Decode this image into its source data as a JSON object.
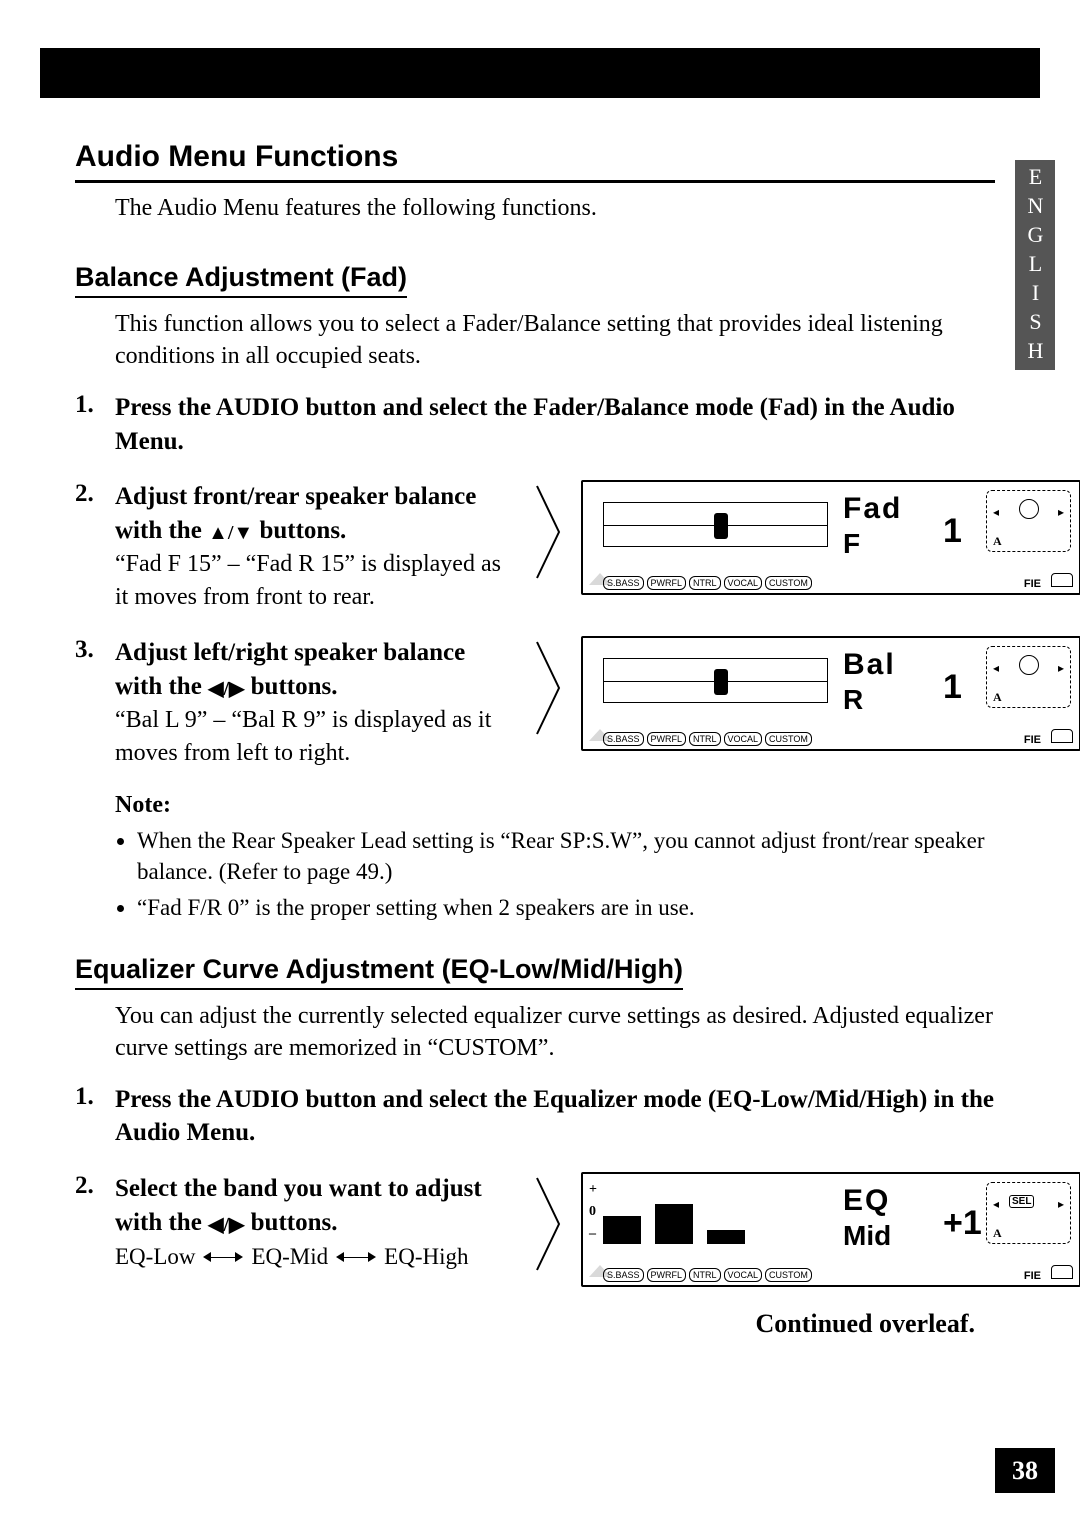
{
  "lang_tab": "ENGLISH",
  "page_number": "38",
  "h1": "Audio Menu Functions",
  "intro": "The Audio Menu features the following functions.",
  "balance": {
    "heading": "Balance Adjustment (Fad)",
    "desc": "This function allows you to select a Fader/Balance setting that provides ideal listening conditions in all occupied seats.",
    "step1": {
      "num": "1.",
      "title": "Press the AUDIO button and select the Fader/Balance mode (Fad) in the Audio Menu."
    },
    "step2": {
      "num": "2.",
      "title_a": "Adjust front/rear speaker balance with the ",
      "title_b": " buttons.",
      "sub": "“Fad F 15” – “Fad R 15” is displayed as it moves from front to rear.",
      "disp": {
        "l1": "Fad",
        "l2": "F",
        "val": "1"
      }
    },
    "step3": {
      "num": "3.",
      "title_a": "Adjust left/right speaker balance with the ",
      "title_b": " buttons.",
      "sub": "“Bal L 9” – “Bal R 9” is displayed as it moves from left to right.",
      "disp": {
        "l1": "Bal",
        "l2": "R",
        "val": "1"
      }
    },
    "note_title": "Note:",
    "note1": "When the Rear Speaker Lead setting is “Rear SP:S.W”, you cannot adjust front/rear speaker balance. (Refer to page 49.)",
    "note2": "“Fad F/R 0” is the proper setting when 2 speakers are in use."
  },
  "eq": {
    "heading": "Equalizer Curve Adjustment (EQ-Low/Mid/High)",
    "desc": "You can adjust the currently selected equalizer curve settings as desired. Adjusted equalizer curve settings are memorized in “CUSTOM”.",
    "step1": {
      "num": "1.",
      "title": "Press the AUDIO button and select the Equalizer mode (EQ-Low/Mid/High) in the Audio Menu."
    },
    "step2": {
      "num": "2.",
      "title_a": "Select the band you want to adjust with the ",
      "title_b": " buttons.",
      "flow_a": "EQ-Low",
      "flow_b": "EQ-Mid",
      "flow_c": "EQ-High",
      "disp": {
        "l1": "EQ",
        "l2": "Mid",
        "val": "+1"
      }
    }
  },
  "presets": {
    "a": "S.BASS",
    "b": "PWRFL",
    "c": "NTRL",
    "d": "VOCAL",
    "e": "CUSTOM"
  },
  "fie": "FIE",
  "dial_a": "A",
  "sel": "SEL",
  "plus": "+",
  "zero": "0",
  "minus": "–",
  "continued": "Continued overleaf."
}
